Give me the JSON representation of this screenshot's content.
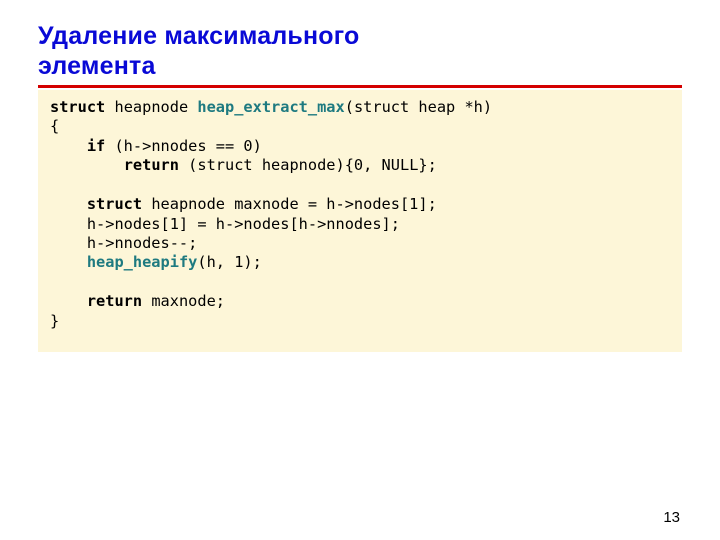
{
  "title_line1": "Удаление максимального",
  "title_line2": "элемента",
  "code": {
    "kw_struct": "struct",
    "kw_if": "if",
    "kw_return": "return",
    "fn_extract": "heap_extract_max",
    "fn_heapify": "heap_heapify",
    "sig_tail": "(struct heap *h)",
    "open_brace": "{",
    "if_cond": " (h->nnodes == 0)",
    "ret_empty": " (struct heapnode){0, NULL};",
    "decl_tail": " heapnode maxnode = h->nodes[1];",
    "assign1": "    h->nodes[1] = h->nodes[h->nnodes];",
    "assign2": "    h->nnodes--;",
    "heapify_args": "(h, 1);",
    "ret_max": " maxnode;",
    "close_brace": "}",
    "sp4": "    ",
    "sp8": "        ",
    "sp_decl_gap": " ",
    "sp_fn_gap": " "
  },
  "page_number": "13"
}
